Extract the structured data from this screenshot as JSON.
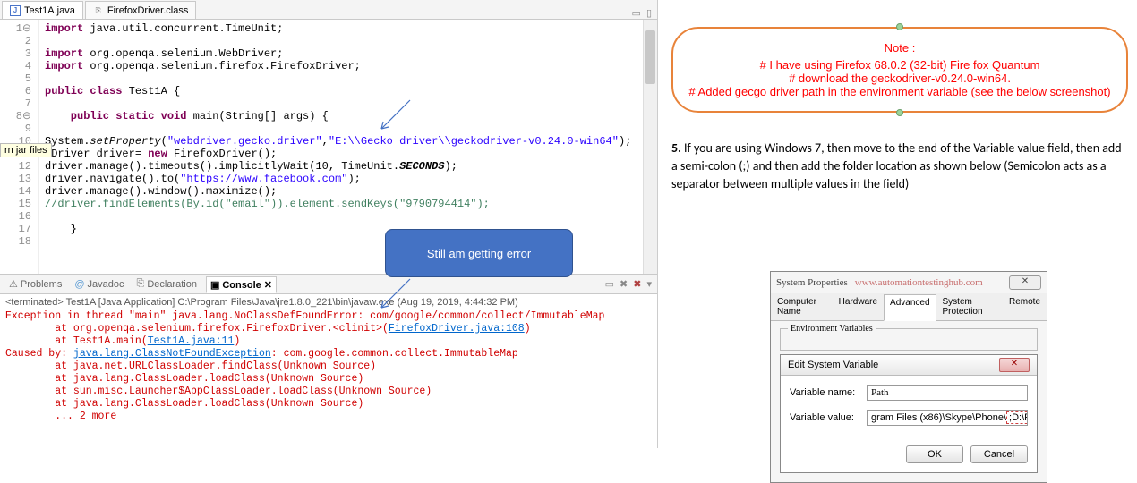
{
  "tabs": {
    "file1": "Test1A.java",
    "file2": "FirefoxDriver.class"
  },
  "code": {
    "l1": "import java.util.concurrent.TimeUnit;",
    "l3": "import org.openqa.selenium.WebDriver;",
    "l4": "import org.openqa.selenium.firefox.FirefoxDriver;",
    "l6a": "public class",
    "l6b": " Test1A {",
    "l8a": "    public static void",
    "l8b": " main(String[] args) {",
    "l10a": "System.setProperty(",
    "l10b": "\"webdriver.gecko.driver\"",
    "l10c": ",",
    "l10d": "\"E:\\\\Gecko driver\\\\geckodriver-v0.24.0-win64\"",
    "l10e": ");",
    "l11a": "bDriver driver= ",
    "l11b": "new",
    "l11c": " FirefoxDriver();",
    "l12a": "driver.manage().timeouts().implicitlyWait(10, TimeUnit.",
    "l12b": "SECONDS",
    "l12c": ");",
    "l13a": "driver.navigate().to(",
    "l13b": "\"https://www.facebook.com\"",
    "l13c": ");",
    "l14": "driver.manage().window().maximize();",
    "l15": "//driver.findElements(By.id(\"email\")).element.sendKeys(\"9790794414\");",
    "l17": "    }"
  },
  "tooltip": "rn jar files",
  "views": {
    "problems": "Problems",
    "javadoc": "Javadoc",
    "declaration": "Declaration",
    "console": "Console"
  },
  "terminated": "<terminated> Test1A [Java Application] C:\\Program Files\\Java\\jre1.8.0_221\\bin\\javaw.exe (Aug 19, 2019, 4:44:32 PM)",
  "console": {
    "l1": "Exception in thread \"main\" java.lang.NoClassDefFoundError: com/google/common/collect/ImmutableMap",
    "l2a": "        at org.openqa.selenium.firefox.FirefoxDriver.<clinit>(",
    "l2b": "FirefoxDriver.java:108",
    "l2c": ")",
    "l3a": "        at Test1A.main(",
    "l3b": "Test1A.java:11",
    "l3c": ")",
    "l4a": "Caused by: ",
    "l4b": "java.lang.ClassNotFoundException",
    "l4c": ": com.google.common.collect.ImmutableMap",
    "l5": "        at java.net.URLClassLoader.findClass(Unknown Source)",
    "l6": "        at java.lang.ClassLoader.loadClass(Unknown Source)",
    "l7": "        at sun.misc.Launcher$AppClassLoader.loadClass(Unknown Source)",
    "l8": "        at java.lang.ClassLoader.loadClass(Unknown Source)",
    "l9": "        ... 2 more"
  },
  "callout": "Still am getting error",
  "note": {
    "title": "Note :",
    "l1": "#  I have using  Firefox 68.0.2 (32-bit) Fire fox Quantum",
    "l2": "# download the geckodriver-v0.24.0-win64.",
    "l3": "# Added gecgo driver path in  the environment variable (see the below screenshot)"
  },
  "step5": {
    "num": "5.",
    "text": " If you are using Windows 7, then move to the end of the Variable value field, then add a semi-colon (;) and then add the folder location as shown below (Semicolon acts as a separator between multiple values in the field)"
  },
  "sys": {
    "title": "System Properties",
    "url": "www.automationtestinghub.com",
    "closebtn": "✕",
    "tabs": {
      "t1": "Computer Name",
      "t2": "Hardware",
      "t3": "Advanced",
      "t4": "System Protection",
      "t5": "Remote"
    },
    "env": "Environment Variables",
    "edit": {
      "title": "Edit System Variable",
      "x": "✕",
      "name_lbl": "Variable name:",
      "name_val": "Path",
      "val_lbl": "Variable value:",
      "val_val": "gram Files (x86)\\Skype\\Phone\\",
      "val_hl": ";D:\\Firefox\\",
      "ok": "OK",
      "cancel": "Cancel"
    }
  }
}
